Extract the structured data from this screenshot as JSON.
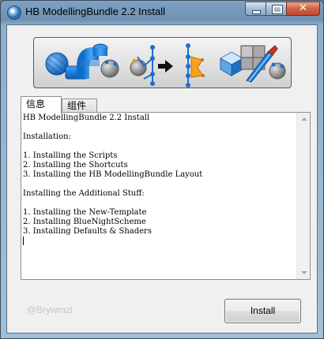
{
  "window": {
    "title": "HB ModellingBundle 2.2 Install",
    "controls": {
      "close_glyph": "✕"
    }
  },
  "banner": {
    "icons": [
      "sphere-pipe-icon",
      "vertex-arrow-icon",
      "cube-knife-icon"
    ],
    "colors": {
      "accent_blue": "#1f7fd6",
      "vertex_orange": "#f39a1a",
      "gray_sphere": "#8e8e8e"
    }
  },
  "tabs": [
    {
      "label": "信息",
      "active": true
    },
    {
      "label": "组件",
      "active": false
    }
  ],
  "log": {
    "lines": [
      "HB ModellingBundle 2.2 Install",
      "",
      "Installation:",
      "",
      "1. Installing the Scripts",
      "2. Installing the Shortcuts",
      "3. Installing the HB ModellingBundle Layout",
      "",
      "Installing the Additional Stuff:",
      "",
      "1. Installing the New-Template",
      "2. Installing BlueNightScheme",
      "3. Installing Defaults & Shaders"
    ]
  },
  "footer": {
    "watermark": "@Brywmzl",
    "install_label": "Install"
  }
}
